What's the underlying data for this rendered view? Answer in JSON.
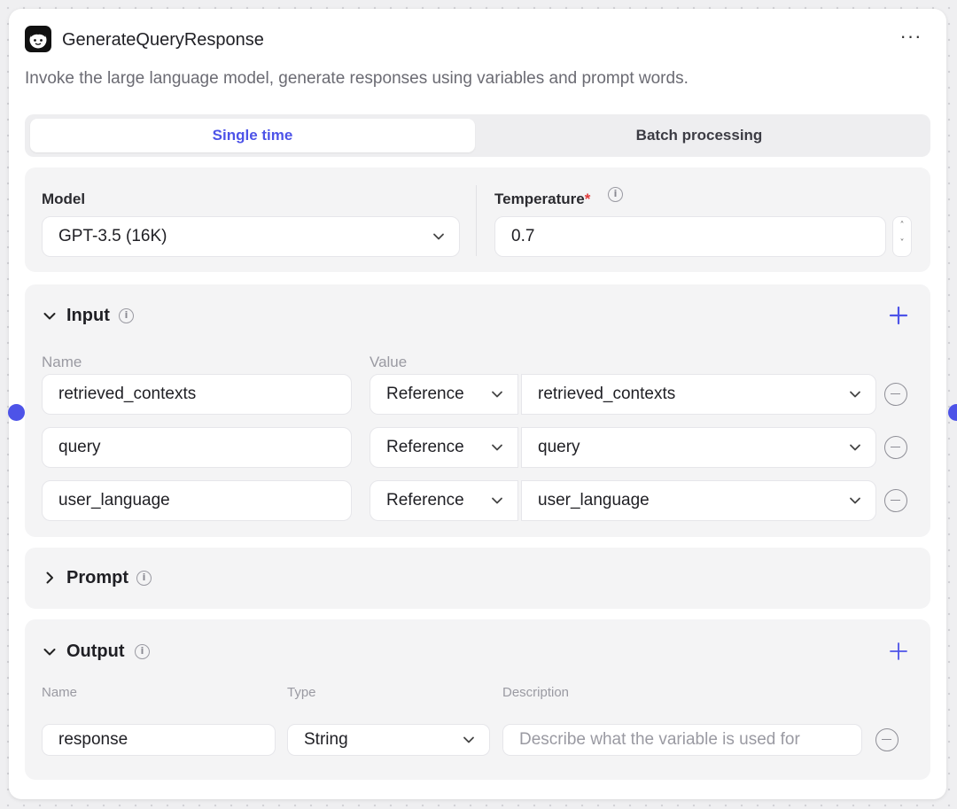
{
  "node": {
    "title": "GenerateQueryResponse",
    "description": "Invoke the large language model, generate responses using variables and prompt words.",
    "more_label": "···"
  },
  "mode_tabs": [
    {
      "label": "Single time",
      "active": true
    },
    {
      "label": "Batch processing",
      "active": false
    }
  ],
  "model": {
    "label": "Model",
    "value": "GPT-3.5 (16K)",
    "temperature_label": "Temperature",
    "required_mark": "*",
    "temperature_value": "0.7"
  },
  "input": {
    "title": "Input",
    "name_header": "Name",
    "value_header": "Value",
    "rows": [
      {
        "name": "retrieved_contexts",
        "mode": "Reference",
        "value": "retrieved_contexts"
      },
      {
        "name": "query",
        "mode": "Reference",
        "value": "query"
      },
      {
        "name": "user_language",
        "mode": "Reference",
        "value": "user_language"
      }
    ]
  },
  "prompt": {
    "title": "Prompt"
  },
  "output": {
    "title": "Output",
    "name_header": "Name",
    "type_header": "Type",
    "description_header": "Description",
    "rows": [
      {
        "name": "response",
        "type": "String",
        "description_placeholder": "Describe what the variable is used for"
      }
    ]
  },
  "colors": {
    "accent": "#4d53e8",
    "required": "#e03a3a",
    "panel_bg": "#f4f4f5"
  },
  "icons": [
    "node-logo-icon",
    "more-icon",
    "info-icon",
    "chevron-down-icon",
    "chevron-right-icon",
    "plus-icon",
    "minus-circle-icon",
    "stepper-icon"
  ]
}
